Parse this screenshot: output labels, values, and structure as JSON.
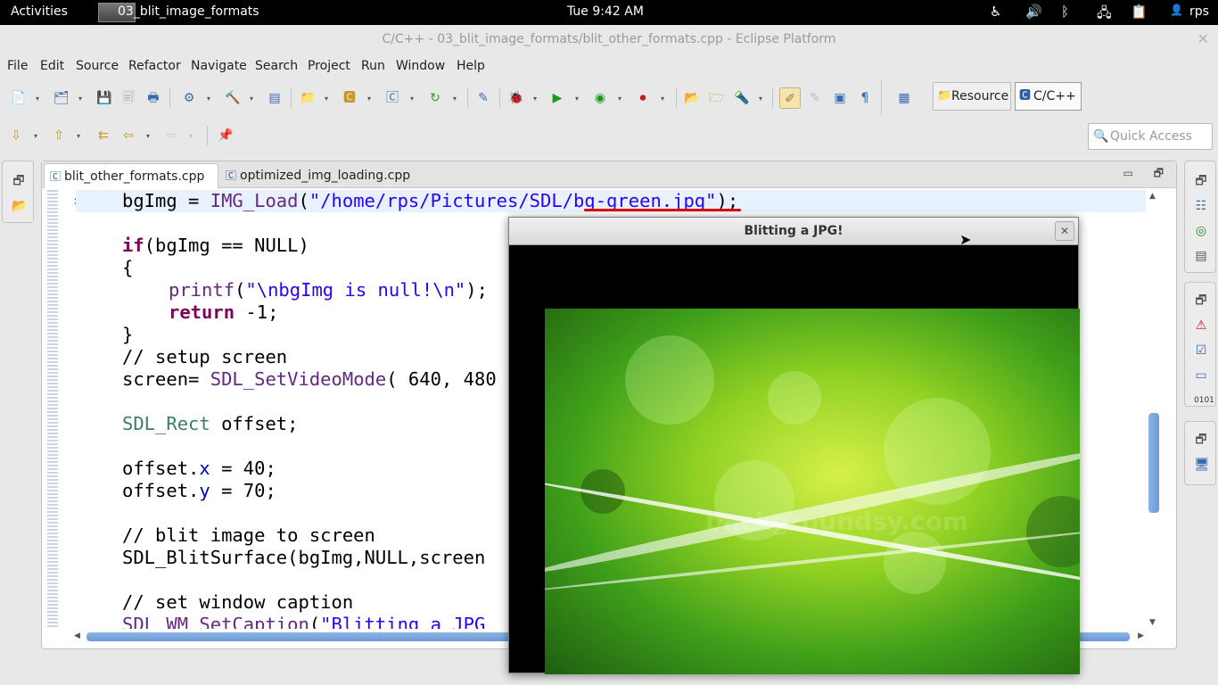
{
  "topbar": {
    "activities": "Activities",
    "app_name": "03_blit_image_formats",
    "clock": "Tue  9:42 AM",
    "user": "rps"
  },
  "window": {
    "title": "C/C++ - 03_blit_image_formats/blit_other_formats.cpp - Eclipse Platform"
  },
  "menu": [
    "File",
    "Edit",
    "Source",
    "Refactor",
    "Navigate",
    "Search",
    "Project",
    "Run",
    "Window",
    "Help"
  ],
  "perspectives": {
    "resource": "Resource",
    "cpp": "C/C++"
  },
  "quick_access": {
    "placeholder": "Quick Access"
  },
  "tabs": [
    {
      "label": "blit_other_formats.cpp"
    },
    {
      "label": "optimized_img_loading.cpp"
    }
  ],
  "code": {
    "l1": {
      "a": "bgImg = ",
      "fn": "IMG_Load",
      "b": "(",
      "str": "\"/home/rps/Pictures/SDL/bg-green.jpg\"",
      "c": ");"
    },
    "l2": {
      "kw": "if",
      "rest": "(bgImg == NULL)"
    },
    "l3": "{",
    "l4": {
      "fn": "printf",
      "b": "(",
      "str": "\"\\nbgImg is null!\\n\"",
      "c": ");"
    },
    "l5": {
      "kw": "return",
      "rest": " -1;"
    },
    "l6": "}",
    "l7": "// setup screen",
    "l8": {
      "a": "screen= ",
      "fn": "SDL_SetVideoMode",
      "b": "( 640, 480"
    },
    "l9": {
      "fn": "SDL_Rect",
      "b": " offset;"
    },
    "l10": {
      "a": "offset.",
      "fld": "x",
      "b": " = 40;"
    },
    "l11": {
      "a": "offset.",
      "fld": "y",
      "b": " = 70;"
    },
    "l12": "// blit image to screen",
    "l13": "SDL_BlitSurface(bgImg,NULL,screen",
    "l14": "// set window caption",
    "l15": {
      "fn": "SDL_WM_SetCaption",
      "b": "(",
      "str": "\"Blitting a JPG"
    }
  },
  "sdl_window": {
    "title": "Blitting a JPG!"
  },
  "image": {
    "watermark": "backgroundsy.com"
  },
  "colors": {
    "keyword": "#7f0055",
    "string": "#2a00ff",
    "comment": "#3f7f5f",
    "function": "#642880",
    "field": "#0000c0"
  }
}
